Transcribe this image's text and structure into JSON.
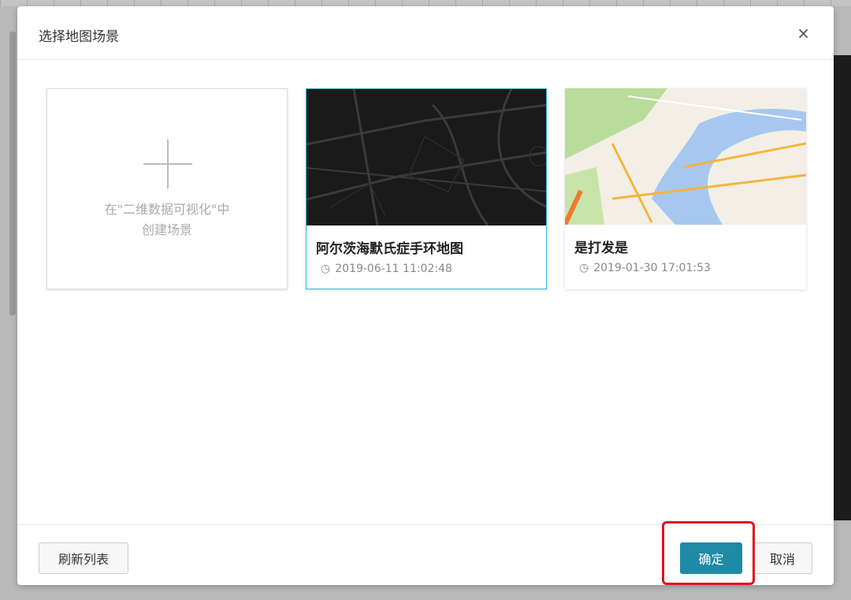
{
  "dialog": {
    "title": "选择地图场景",
    "close_label": "×"
  },
  "add_card": {
    "line1": "在\"二维数据可视化\"中",
    "line2": "创建场景"
  },
  "cards": [
    {
      "title": "阿尔茨海默氏症手环地图",
      "date": "2019-06-11 11:02:48",
      "theme": "dark",
      "selected": true
    },
    {
      "title": "是打发是",
      "date": "2019-01-30 17:01:53",
      "theme": "light",
      "selected": false
    }
  ],
  "footer": {
    "refresh_label": "刷新列表",
    "ok_label": "确定",
    "cancel_label": "取消"
  },
  "colors": {
    "primary": "#1e8aa6",
    "selected_border": "#3ab4d4",
    "highlight": "#e0141e"
  }
}
